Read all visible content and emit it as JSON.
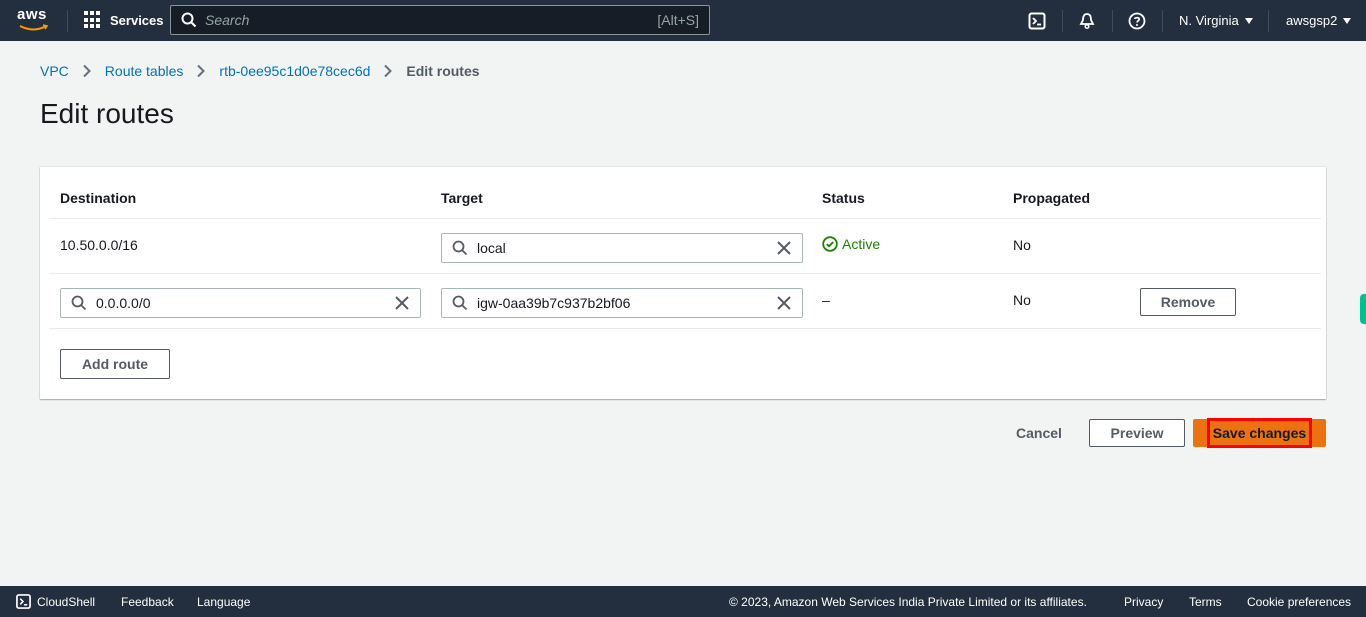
{
  "topnav": {
    "logo_text": "aws",
    "services_label": "Services",
    "search_placeholder": "Search",
    "search_shortcut": "[Alt+S]",
    "region": "N. Virginia",
    "account": "awsgsp2",
    "icons": [
      "cloudshell-icon",
      "notifications-bell-icon",
      "help-icon"
    ]
  },
  "breadcrumb": {
    "items": [
      "VPC",
      "Route tables",
      "rtb-0ee95c1d0e78cec6d"
    ],
    "current": "Edit routes"
  },
  "page": {
    "title": "Edit routes"
  },
  "routes": {
    "columns": [
      "Destination",
      "Target",
      "Status",
      "Propagated"
    ],
    "rows": [
      {
        "destination": "10.50.0.0/16",
        "destination_editable": false,
        "target": "local",
        "status": "Active",
        "propagated": "No",
        "removable": false
      },
      {
        "destination": "0.0.0.0/0",
        "destination_editable": true,
        "target": "igw-0aa39b7c937b2bf06",
        "status": "–",
        "propagated": "No",
        "removable": true,
        "remove_label": "Remove"
      }
    ],
    "add_route_label": "Add route"
  },
  "actions": {
    "cancel_label": "Cancel",
    "preview_label": "Preview",
    "save_label": "Save changes"
  },
  "colors": {
    "primary": "#ec7211",
    "link": "#0073bb",
    "success": "#1d8102",
    "nav_bg": "#232f3e",
    "highlight": "#ff0000"
  },
  "footer": {
    "cloudshell": "CloudShell",
    "feedback": "Feedback",
    "language": "Language",
    "copyright": "© 2023, Amazon Web Services India Private Limited or its affiliates.",
    "privacy": "Privacy",
    "terms": "Terms",
    "cookie": "Cookie preferences"
  }
}
